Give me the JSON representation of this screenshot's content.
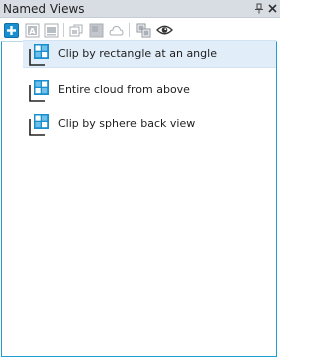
{
  "panel": {
    "title": "Named Views"
  },
  "toolbar": {
    "tools": [
      {
        "icon": "add-view-icon"
      },
      {
        "icon": "rename-view-icon"
      },
      {
        "icon": "update-view-icon"
      },
      {
        "icon": "copy-view-icon"
      },
      {
        "icon": "fill-view-icon"
      },
      {
        "icon": "cloud-view-icon"
      },
      {
        "icon": "stack-view-icon"
      },
      {
        "icon": "eye-icon"
      }
    ]
  },
  "views": [
    {
      "label": "Clip by rectangle at an angle",
      "selected": true
    },
    {
      "label": "Entire cloud from above",
      "selected": false
    },
    {
      "label": "Clip by sphere back view",
      "selected": false
    }
  ],
  "colors": {
    "accent": "#1a8fd0",
    "selection": "#e1eef9",
    "titlebar": "#d8dde3"
  }
}
